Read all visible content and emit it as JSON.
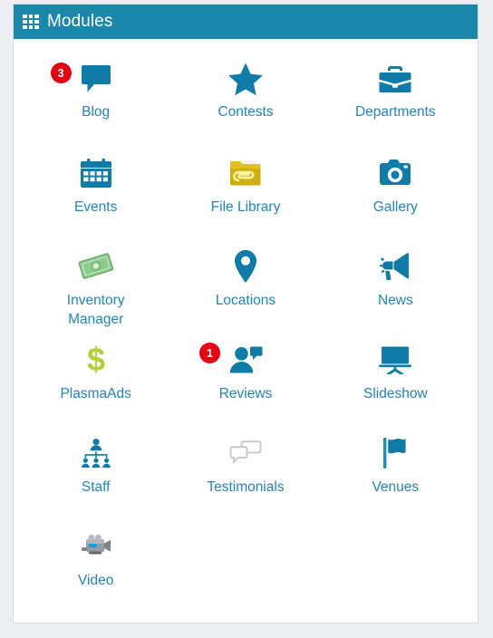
{
  "panel": {
    "header": {
      "title": "Modules",
      "icon": "grid-icon",
      "background_color": "#1b87ab",
      "text_color": "#ffffff"
    },
    "background_color": "#ffffff",
    "border_color": "#d8dde0"
  },
  "theme": {
    "page_background": "#eceeef",
    "label_color": "#2285bd",
    "icon_color": "#0f7ba6",
    "badge_color": "#e60012",
    "badge_text_color": "#ffffff",
    "folder_color": "#e3c313",
    "money_color": "#7dc27d",
    "dollar_color": "#b2cf3f",
    "gray_icon_color": "#c9cdd0",
    "video_color": "#8d949a"
  },
  "modules": [
    {
      "label": "Blog",
      "icon": "comment-icon",
      "badge": "3"
    },
    {
      "label": "Contests",
      "icon": "star-icon",
      "badge": null
    },
    {
      "label": "Departments",
      "icon": "briefcase-icon",
      "badge": null
    },
    {
      "label": "Events",
      "icon": "calendar-icon",
      "badge": null
    },
    {
      "label": "File Library",
      "icon": "folder-clip-icon",
      "badge": null
    },
    {
      "label": "Gallery",
      "icon": "camera-icon",
      "badge": null
    },
    {
      "label": "Inventory Manager",
      "icon": "money-bill-icon",
      "badge": null
    },
    {
      "label": "Locations",
      "icon": "map-pin-icon",
      "badge": null
    },
    {
      "label": "News",
      "icon": "megaphone-icon",
      "badge": null
    },
    {
      "label": "PlasmaAds",
      "icon": "dollar-sign-icon",
      "badge": null
    },
    {
      "label": "Reviews",
      "icon": "user-comment-icon",
      "badge": "1"
    },
    {
      "label": "Slideshow",
      "icon": "projector-icon",
      "badge": null
    },
    {
      "label": "Staff",
      "icon": "org-chart-icon",
      "badge": null
    },
    {
      "label": "Testimonials",
      "icon": "comments-icon",
      "badge": null
    },
    {
      "label": "Venues",
      "icon": "flag-icon",
      "badge": null
    },
    {
      "label": "Video",
      "icon": "camcorder-icon",
      "badge": null
    }
  ]
}
